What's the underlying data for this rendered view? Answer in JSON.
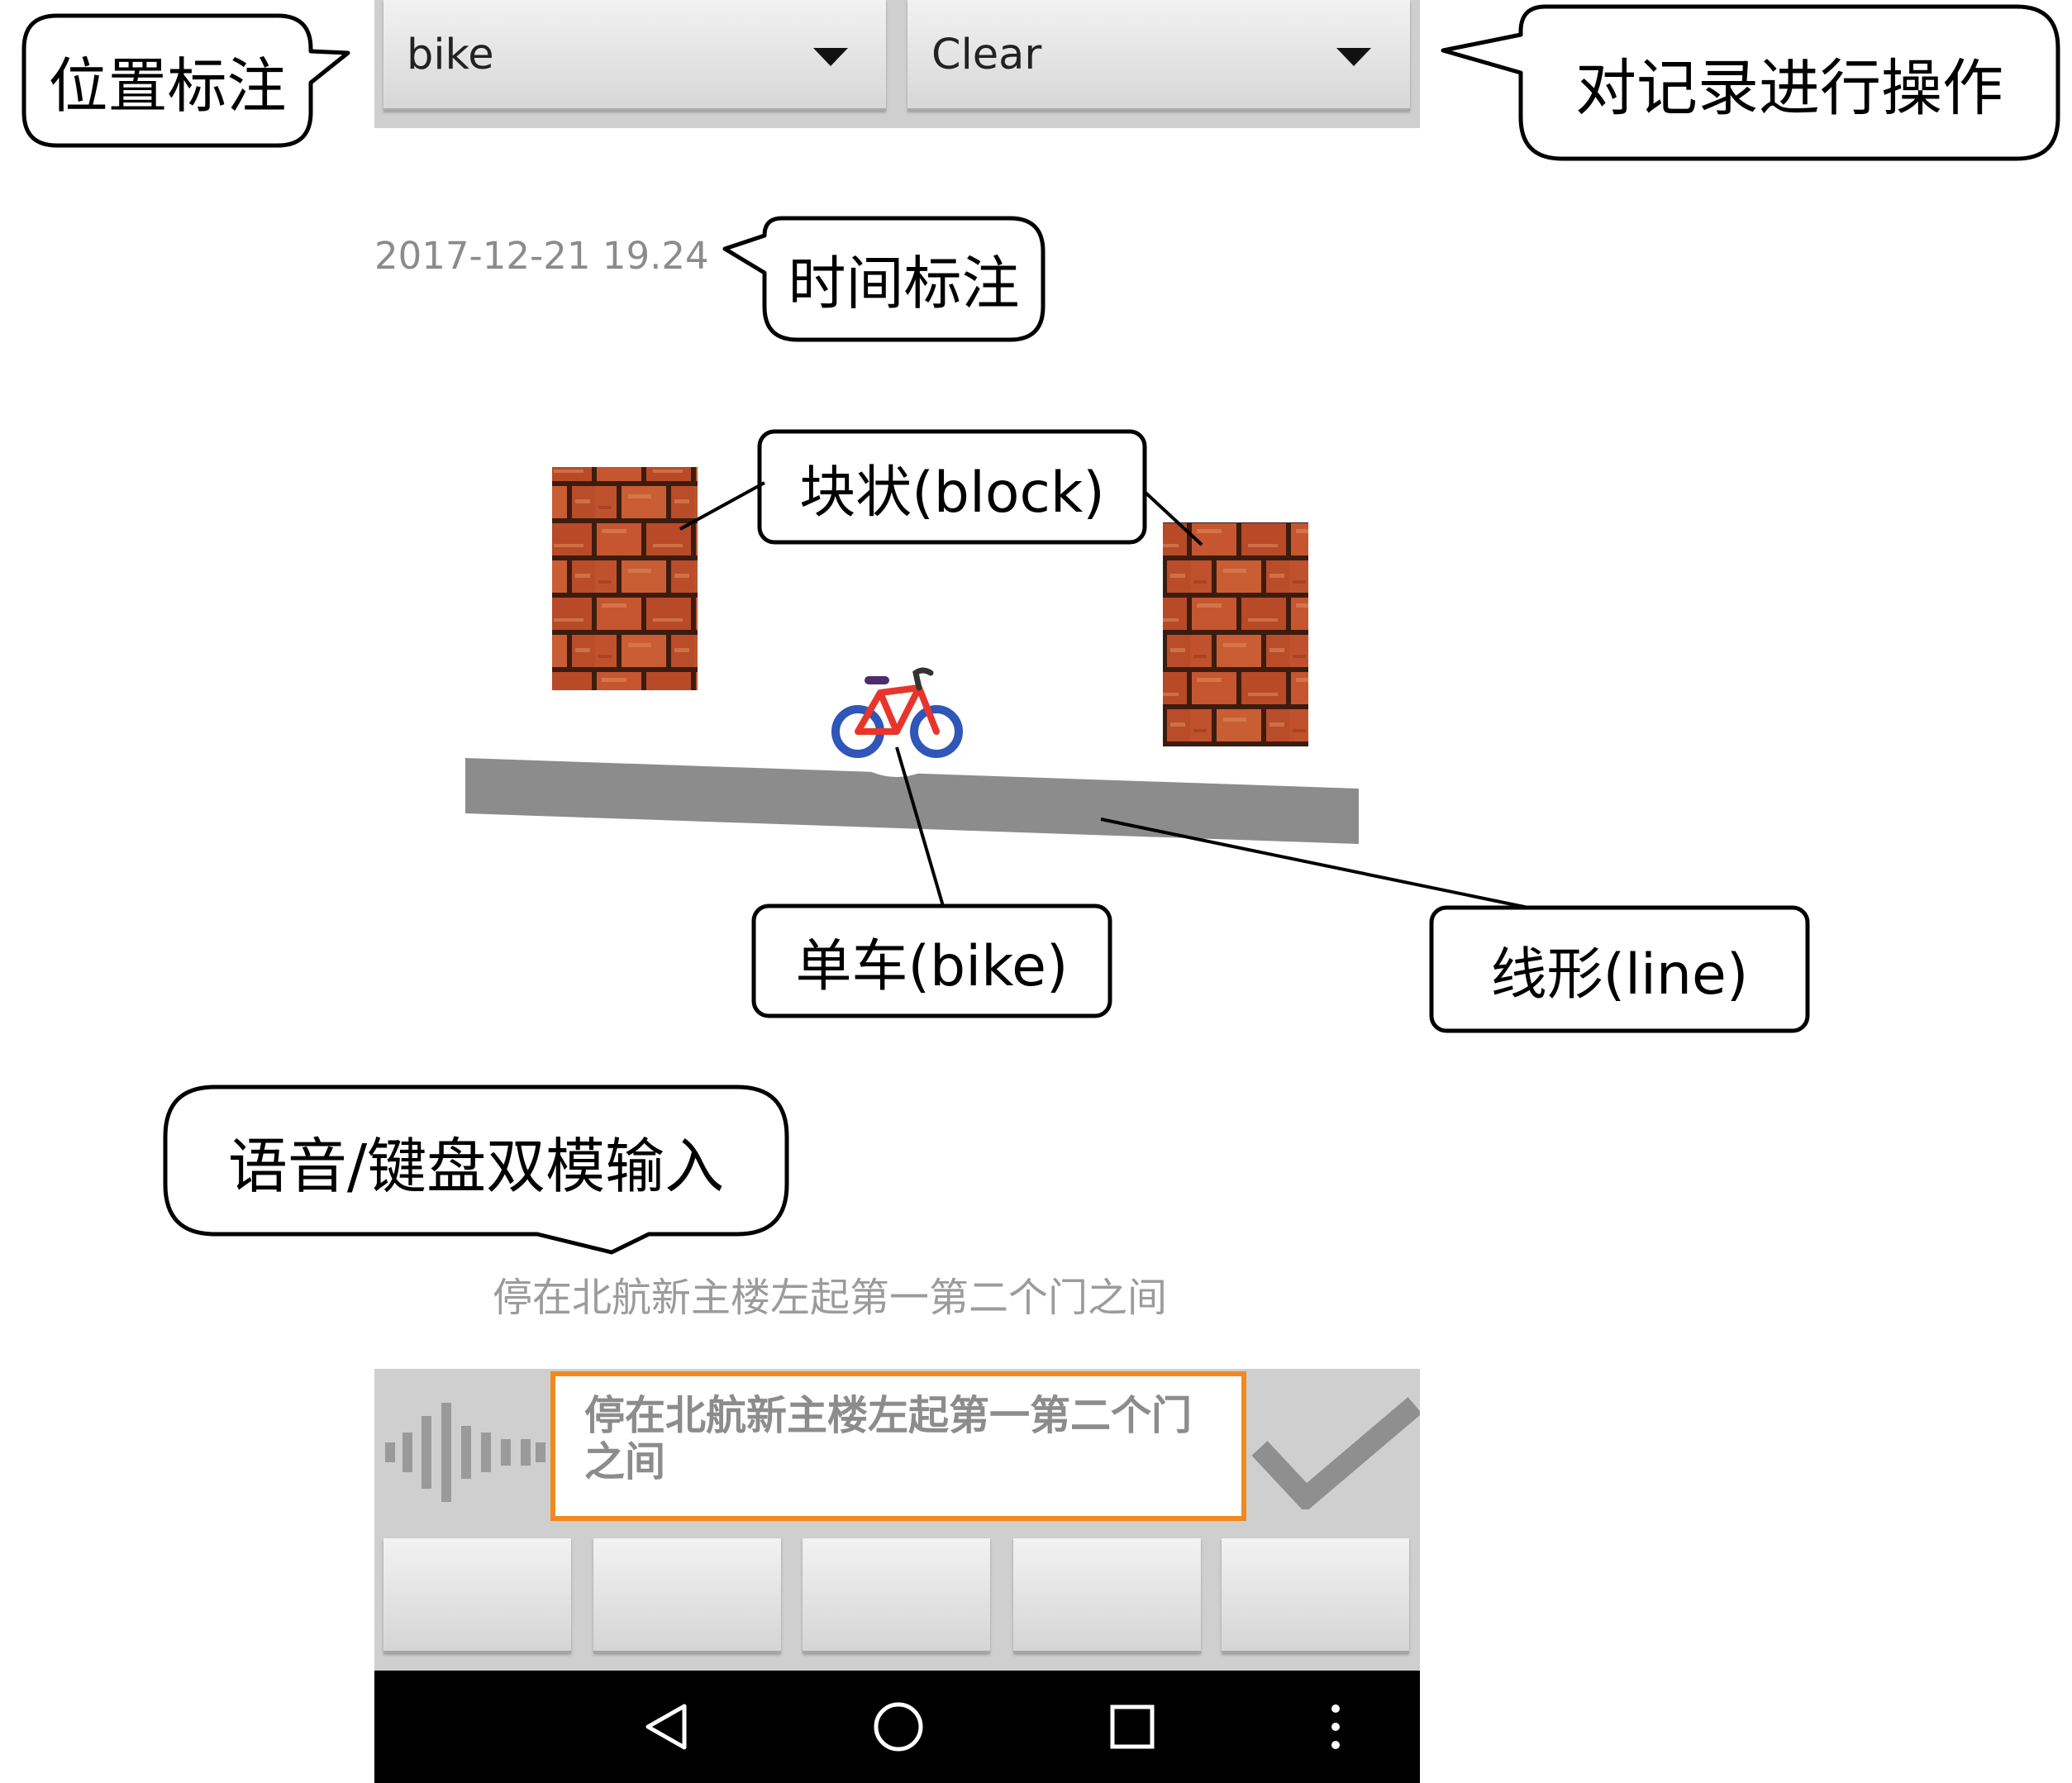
{
  "annotations": {
    "location_callout": "位置标注",
    "operation_callout": "对记录进行操作",
    "time_callout": "时间标注",
    "input_callout": "语音/键盘双模输入",
    "block_label": "块状(block)",
    "bike_label": "单车(bike)",
    "line_label": "线形(line)"
  },
  "toolbar": {
    "location_spinner": {
      "selected": "bike",
      "icon": "dropdown-arrow-icon"
    },
    "action_spinner": {
      "selected": "Clear",
      "icon": "dropdown-arrow-icon"
    }
  },
  "record": {
    "timestamp": "2017-12-21 19.24",
    "note": "停在北航新主楼左起第一第二个门之间"
  },
  "map": {
    "icons": [
      "brick-wall-icon",
      "brick-wall-icon",
      "bicycle-icon",
      "road-line"
    ]
  },
  "input_panel": {
    "voice_icon": "voice-waveform-icon",
    "text_value": "停在北航新主楼左起第一第二个门之间",
    "confirm_icon": "checkmark-icon"
  },
  "nav_bar": {
    "icons": [
      "back-icon",
      "home-icon",
      "recents-icon",
      "menu-icon"
    ]
  },
  "colors": {
    "accent": "#f08a1e",
    "road": "#8c8c8c",
    "brick": "#c1532e",
    "panel": "#cfcfcf",
    "nav": "#000000"
  }
}
